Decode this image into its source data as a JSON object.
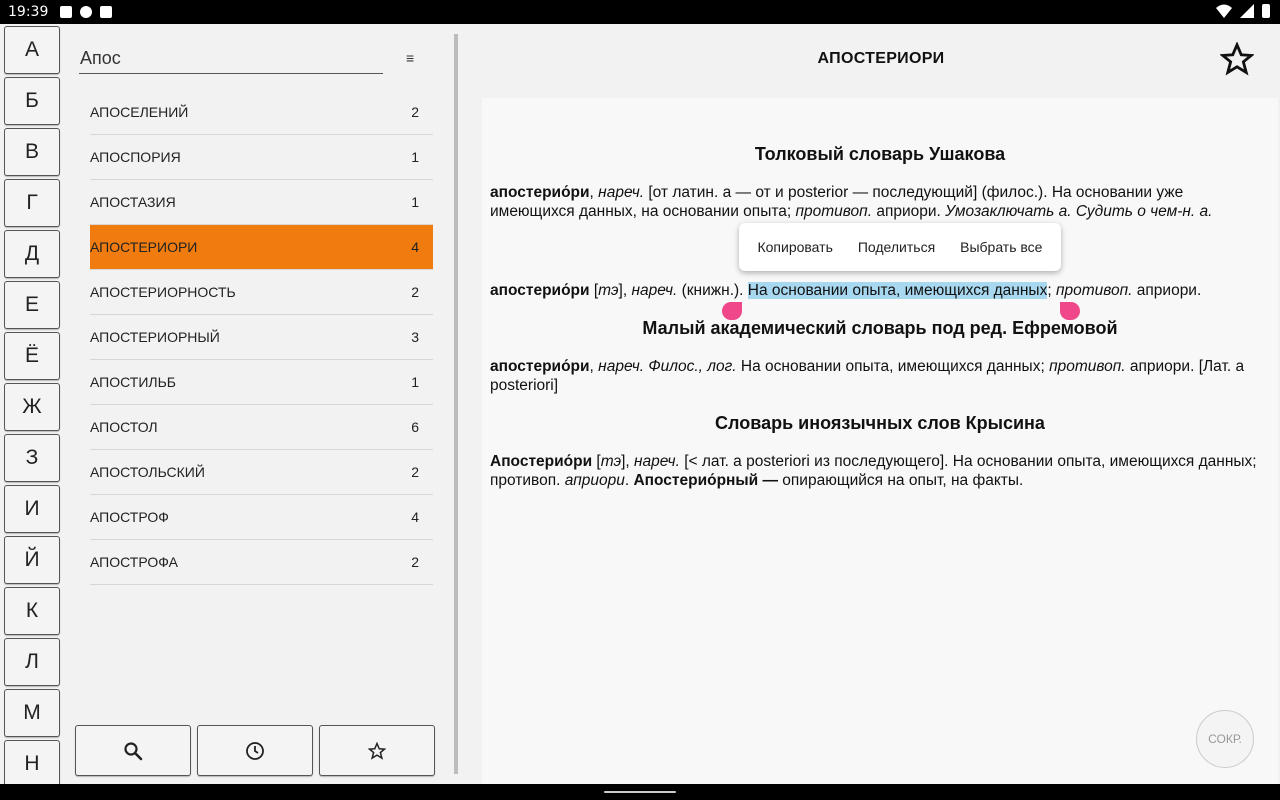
{
  "status": {
    "time": "19:39"
  },
  "letters": [
    "А",
    "Б",
    "В",
    "Г",
    "Д",
    "Е",
    "Ё",
    "Ж",
    "З",
    "И",
    "Й",
    "К",
    "Л",
    "М",
    "Н"
  ],
  "search": {
    "value": "Апос"
  },
  "words": [
    {
      "word": "АПОСЕЛЕНИЙ",
      "count": "2"
    },
    {
      "word": "АПОСПОРИЯ",
      "count": "1"
    },
    {
      "word": "АПОСТАЗИЯ",
      "count": "1"
    },
    {
      "word": "АПОСТЕРИОРИ",
      "count": "4"
    },
    {
      "word": "АПОСТЕРИОРНОСТЬ",
      "count": "2"
    },
    {
      "word": "АПОСТЕРИОРНЫЙ",
      "count": "3"
    },
    {
      "word": "АПОСТИЛЬБ",
      "count": "1"
    },
    {
      "word": "АПОСТОЛ",
      "count": "6"
    },
    {
      "word": "АПОСТОЛЬСКИЙ",
      "count": "2"
    },
    {
      "word": "АПОСТРОФ",
      "count": "4"
    },
    {
      "word": "АПОСТРОФА",
      "count": "2"
    }
  ],
  "selected_index": 3,
  "accent_color": "#f07c10",
  "bottom_icons": [
    "search-icon",
    "history-icon",
    "favorites-icon"
  ],
  "detail": {
    "title": "АПОСТЕРИОРИ",
    "s1": {
      "heading": "Толковый словарь Ушакова",
      "p1_word": "апостерио́ри",
      "p1_a": ", ",
      "p1_b": "нареч.",
      "p1_c": " [от латин. a — от и posterior — последующий] (филос.). На основании уже имеющихся данных, на основании опыта; ",
      "p1_d": "противоп.",
      "p1_e": " априори. ",
      "p1_f": "Умозаключать а. Судить о чем-н. а.",
      "p2_word": "апостерио́ри",
      "p2_a": " [",
      "p2_b": "тэ",
      "p2_c": "], ",
      "p2_d": "нареч.",
      "p2_e": " (книжн.). ",
      "p2_hl": "На основании опыта, имеющихся данных",
      "p2_f": "; ",
      "p2_g": "противоп.",
      "p2_h": " априори."
    },
    "s2": {
      "heading": "Малый академический словарь под ред. Ефремовой",
      "word": "апостерио́ри",
      "a": ", ",
      "b": "нареч. Филос., лог.",
      "c": " На основании опыта, имеющихся данных; ",
      "d": "противоп.",
      "e": " априори. [Лат. a posteriori]"
    },
    "s3": {
      "heading": "Словарь иноязычных слов Крысина",
      "word": "Апостерио́ри",
      "a": " [",
      "b": "тэ",
      "c": "], ",
      "d": "нареч.",
      "e": " [< лат. a posteriori из последующего]. На основании опыта, имеющихся данных; противоп. ",
      "f": "априори",
      "g": ". ",
      "word2": "Апостерио́рный —",
      "h": " опирающийся на опыт, на факты."
    },
    "context_menu": {
      "copy": "Копировать",
      "share": "Поделиться",
      "select_all": "Выбрать все"
    },
    "sokr": "СОКР."
  }
}
